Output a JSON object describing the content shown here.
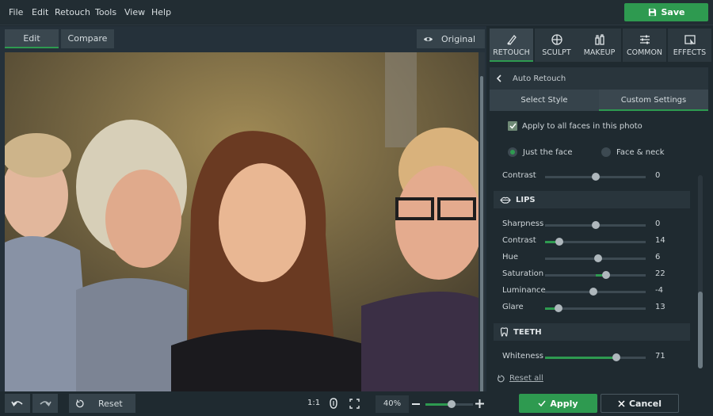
{
  "menubar": {
    "items": [
      "File",
      "Edit",
      "Retouch",
      "Tools",
      "View",
      "Help"
    ],
    "save_label": "Save"
  },
  "workspace": {
    "edit_tab": "Edit",
    "compare_tab": "Compare",
    "original_label": "Original"
  },
  "bottombar": {
    "reset_label": "Reset",
    "one_to_one": "1:1",
    "zoom": "40%",
    "zoom_level": 0.55
  },
  "panel": {
    "tabs": [
      "RETOUCH",
      "SCULPT",
      "MAKEUP",
      "COMMON",
      "EFFECTS"
    ],
    "breadcrumb": "Auto Retouch",
    "style_tab": "Select Style",
    "custom_tab": "Custom Settings",
    "apply_all_label": "Apply to all faces in this photo",
    "radio_face": "Just the face",
    "radio_neck": "Face & neck",
    "contrast": {
      "label": "Contrast",
      "value": "0",
      "min": -100,
      "max": 100,
      "num": 0
    },
    "lips_title": "LIPS",
    "lips": [
      {
        "label": "Sharpness",
        "value": "0",
        "num": 0,
        "min": -100,
        "max": 100,
        "bipolar": true
      },
      {
        "label": "Contrast",
        "value": "14",
        "num": 14,
        "min": 0,
        "max": 100,
        "bipolar": false
      },
      {
        "label": "Hue",
        "value": "6",
        "num": 6,
        "min": -100,
        "max": 100,
        "bipolar": true
      },
      {
        "label": "Saturation",
        "value": "22",
        "num": 22,
        "min": -100,
        "max": 100,
        "bipolar": true
      },
      {
        "label": "Luminance",
        "value": "-4",
        "num": -4,
        "min": -100,
        "max": 100,
        "bipolar": true
      },
      {
        "label": "Glare",
        "value": "13",
        "num": 13,
        "min": 0,
        "max": 100,
        "bipolar": false
      }
    ],
    "teeth_title": "TEETH",
    "teeth": [
      {
        "label": "Whiteness",
        "value": "71",
        "num": 71,
        "min": 0,
        "max": 100,
        "bipolar": false
      }
    ],
    "reset_all": "Reset all",
    "apply": "Apply",
    "cancel": "Cancel"
  },
  "colors": {
    "accent": "#2e9a50",
    "panel": "#1f2a30",
    "track": "#3d4a52"
  }
}
